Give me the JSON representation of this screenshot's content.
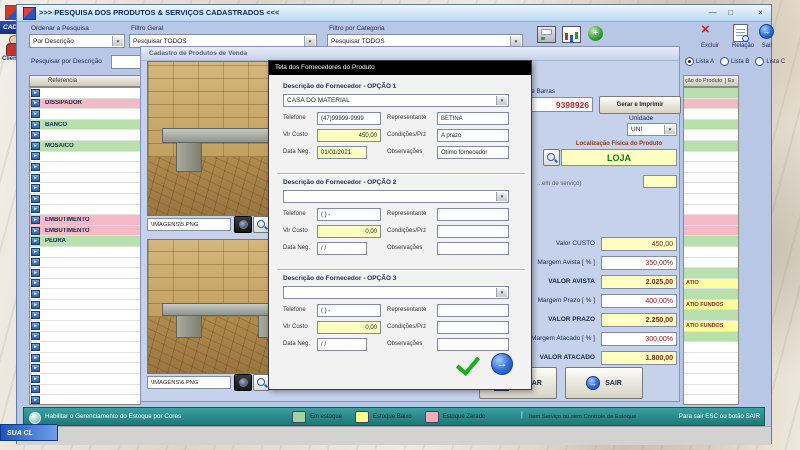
{
  "icons": {
    "minimize": "—",
    "maximize": "□",
    "close": "×",
    "dropdown": "▼",
    "selector": "▸",
    "arrow_right": "→",
    "excluir": "×",
    "add": "+",
    "separator": "|"
  },
  "desktop": {
    "cadast_fragment": "CADAST",
    "client_label": "Client",
    "sua_cl_label": "SUA CL"
  },
  "main_window": {
    "title": ">>>  PESQUISA DOS PRODUTOS & SERVIÇOS CADASTRADOS  <<<",
    "toolbar": {
      "ordenar_label": "Ordenar a Pesquisa",
      "ordenar_value": "Por Descrição",
      "filtro_geral_label": "Filtro Geral",
      "filtro_geral_value": "Pesquisar TODOS",
      "filtro_categoria_label": "Filtro por Categoria",
      "filtro_categoria_value": "Pesquisar TODOS",
      "excluir_label": "Excluir",
      "relacao_label": "Relação",
      "sair_label": "Sair"
    },
    "search_label": "Pesquisar por Descrição",
    "lists": {
      "options": [
        "Lista A",
        "Lista B",
        "Lista C"
      ],
      "selected": "Lista A"
    },
    "table": {
      "header_referencia": "Referencia",
      "header_descricao_fragment": "ção do Produto",
      "header_estoque_fragment": "Es",
      "rows": [
        {
          "name": "",
          "status": "white"
        },
        {
          "name": "DISSIPADOR",
          "status": "pink"
        },
        {
          "name": "",
          "status": "white"
        },
        {
          "name": "BANCO",
          "status": "green"
        },
        {
          "name": "",
          "status": "white"
        },
        {
          "name": "MOSAICO",
          "status": "green"
        },
        {
          "name": "",
          "status": "white"
        },
        {
          "name": "",
          "status": "white"
        },
        {
          "name": "",
          "status": "white"
        },
        {
          "name": "",
          "status": "white"
        },
        {
          "name": "",
          "status": "white"
        },
        {
          "name": "",
          "status": "white"
        },
        {
          "name": "EMBUTIMENTO",
          "status": "pink"
        },
        {
          "name": "EMBUTIMENTO",
          "status": "pink"
        },
        {
          "name": "PEDRA",
          "status": "green"
        },
        {
          "name": "",
          "status": "white"
        },
        {
          "name": "",
          "status": "white"
        },
        {
          "name": "",
          "status": "white"
        },
        {
          "name": "",
          "status": "white"
        },
        {
          "name": "",
          "status": "white"
        },
        {
          "name": "",
          "status": "white"
        },
        {
          "name": "",
          "status": "white"
        },
        {
          "name": "",
          "status": "white"
        },
        {
          "name": "",
          "status": "white"
        },
        {
          "name": "",
          "status": "white"
        },
        {
          "name": "",
          "status": "white"
        },
        {
          "name": "",
          "status": "white"
        },
        {
          "name": "",
          "status": "white"
        },
        {
          "name": "",
          "status": "white"
        },
        {
          "name": "",
          "status": "white"
        }
      ],
      "right_rows": [
        {
          "text": "",
          "status": "green"
        },
        {
          "text": "",
          "status": "pink"
        },
        {
          "text": "",
          "status": "white"
        },
        {
          "text": "",
          "status": "green"
        },
        {
          "text": "",
          "status": "white"
        },
        {
          "text": "",
          "status": "green"
        },
        {
          "text": "",
          "status": "white"
        },
        {
          "text": "",
          "status": "white"
        },
        {
          "text": "",
          "status": "white"
        },
        {
          "text": "",
          "status": "white"
        },
        {
          "text": "",
          "status": "white"
        },
        {
          "text": "",
          "status": "white"
        },
        {
          "text": "",
          "status": "pink"
        },
        {
          "text": "",
          "status": "pink"
        },
        {
          "text": "",
          "status": "green"
        },
        {
          "text": "",
          "status": "white"
        },
        {
          "text": "",
          "status": "white"
        },
        {
          "text": "",
          "status": "green"
        },
        {
          "text": "ATIO",
          "status": "yellow"
        },
        {
          "text": "",
          "status": "green"
        },
        {
          "text": "ATIO FUNDOS",
          "status": "yellow"
        },
        {
          "text": "",
          "status": "green"
        },
        {
          "text": "ATIO FUNDOS",
          "status": "yellow"
        },
        {
          "text": "",
          "status": "green"
        },
        {
          "text": "",
          "status": "white"
        },
        {
          "text": "",
          "status": "white"
        },
        {
          "text": "",
          "status": "white"
        },
        {
          "text": "",
          "status": "white"
        },
        {
          "text": "",
          "status": "white"
        },
        {
          "text": "",
          "status": "white"
        }
      ]
    },
    "statusbar": {
      "toggle_label": "Habilitar o Gerenciamento do Estoque por Cores",
      "legend": [
        {
          "label": "Em estoque",
          "color": "#9fd49a"
        },
        {
          "label": "Estoque Baixo",
          "color": "#ffff8c"
        },
        {
          "label": "Estoque Zerado",
          "color": "#f3aebc"
        }
      ],
      "servico_label": "Item Serviço ou sem Controle de Estoque",
      "exit_hint": "Para sair ESC ou botão SAIR"
    }
  },
  "cadastro": {
    "title": "Cadastro de Produtos de Venda",
    "image1_path": "\\IMAGENS\\5.PNG",
    "image2_path": "\\IMAGENS\\6.PNG",
    "barcode_label": "Código de Barras",
    "barcode_value": "9398926",
    "barcode_button": "Gerar e Imprimir",
    "unidade_label": "Unidade",
    "unidade_value": "UNI",
    "localizacao_label": "Localização Física do Produto",
    "localizacao_value": "LOJA",
    "servico_fragment": "...em de serviço)",
    "pricing": {
      "valor_custo_label": "Valor CUSTO",
      "valor_custo": "450,00",
      "margem_avista_label": "Margem Avista [ % ]",
      "margem_avista": "350,00%",
      "valor_avista_label": "VALOR AVISTA",
      "valor_avista": "2.025,00",
      "margem_prazo_label": "Margem Prazo [ % ]",
      "margem_prazo": "400,00%",
      "valor_prazo_label": "VALOR PRAZO",
      "valor_prazo": "2.250,00",
      "margem_atacado_label": "Margem Atacado [ % ]",
      "margem_atacado": "300,00%",
      "valor_atacado_label": "VALOR ATACADO",
      "valor_atacado": "1.800,00"
    },
    "salvar_label": "SALVAR",
    "sair_label": "SAIR"
  },
  "dialog": {
    "title": "Tela dos Fornecedores do Produto",
    "sections": [
      {
        "label": "Descrição do Fornecedor - OPÇÃO 1",
        "fornecedor": "CASA DO MATERIAL",
        "telefone_label": "Telefone",
        "telefone": "(47)99999-9999",
        "representante_label": "Representante",
        "representante": "BETINA",
        "vlr_custo_label": "Vlr Custo",
        "vlr_custo": "450,00",
        "condicoes_label": "Condições/Prz",
        "condicoes": "A prazo",
        "data_label": "Data Neg.",
        "data": "01/01/2021",
        "obs_label": "Observações",
        "obs": "Otimo fornecedor"
      },
      {
        "label": "Descrição do Fornecedor - OPÇÃO 2",
        "fornecedor": "",
        "telefone_label": "Telefone",
        "telefone": "(  )    -",
        "representante_label": "Representante",
        "representante": "",
        "vlr_custo_label": "Vlr Custo",
        "vlr_custo": "0,00",
        "condicoes_label": "Condições/Prz",
        "condicoes": "",
        "data_label": "Data Neg.",
        "data": "/  /",
        "obs_label": "Observações",
        "obs": ""
      },
      {
        "label": "Descrição do Fornecedor - OPÇÃO 3",
        "fornecedor": "",
        "telefone_label": "Telefone",
        "telefone": "(  )    -",
        "representante_label": "Representante",
        "representante": "",
        "vlr_custo_label": "Vlr Custo",
        "vlr_custo": "0,00",
        "condicoes_label": "Condições/Prz",
        "condicoes": "",
        "data_label": "Data Neg.",
        "data": "/  /",
        "obs_label": "Observações",
        "obs": ""
      }
    ]
  }
}
